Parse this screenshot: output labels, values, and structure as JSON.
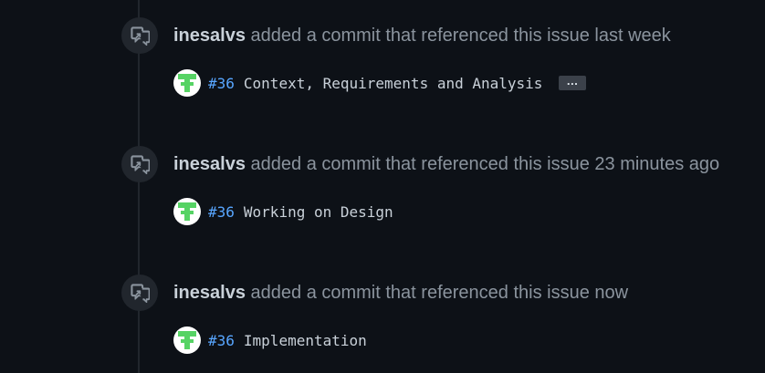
{
  "events": [
    {
      "author": "inesalvs",
      "action": "added a commit that referenced this issue",
      "time": "last week",
      "commit": {
        "ref": "#36",
        "message": "Context, Requirements and Analysis",
        "expand_label": "…"
      }
    },
    {
      "author": "inesalvs",
      "action": "added a commit that referenced this issue",
      "time": "23 minutes ago",
      "commit": {
        "ref": "#36",
        "message": "Working on Design"
      }
    },
    {
      "author": "inesalvs",
      "action": "added a commit that referenced this issue",
      "time": "now",
      "commit": {
        "ref": "#36",
        "message": "Implementation"
      }
    }
  ],
  "icons": {
    "badge": "cross-reference-icon",
    "avatar": "identicon-avatar"
  },
  "colors": {
    "background": "#0d1117",
    "link": "#58a6ff",
    "author": "#c9d1d9",
    "muted": "#8b949e",
    "avatar_green": "#56d364"
  }
}
